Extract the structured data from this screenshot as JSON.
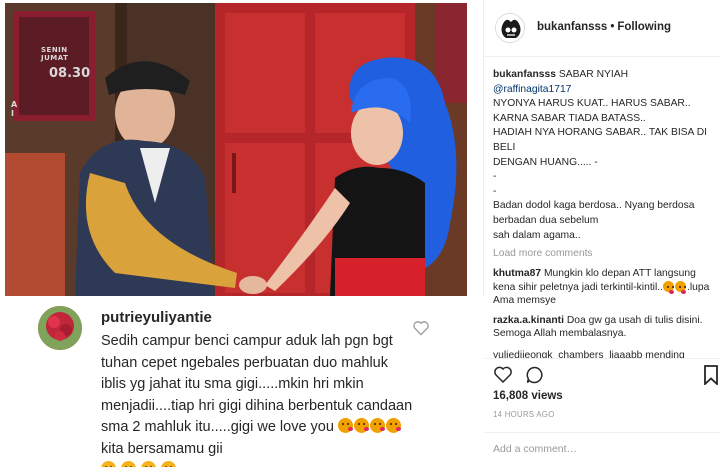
{
  "photo": {
    "wall_day": "SENIN\nJUMAT",
    "wall_time": "08.30",
    "wall_side": "A\nI"
  },
  "overlay_comment": {
    "username": "putrieyuliyantie",
    "text_main": "Sedih campur benci campur aduk lah pgn bgt tuhan cepet ngebales perbuatan duo mahluk iblis yg jahat itu sma gigi.....mkin hri mkin menjadii....tiap hri gigi dihina berbentuk candaan  sma 2 mahluk itu.....gigi we love you",
    "text_tail": "kita bersamamu gii"
  },
  "header": {
    "username": "bukanfansss",
    "separator": "•",
    "follow_status": "Following"
  },
  "caption": {
    "username": "bukanfansss",
    "title": "SABAR NYIAH",
    "mention": "@raffinagita1717",
    "lines": [
      "NYONYA HARUS KUAT.. HARUS SABAR..",
      "KARNA SABAR TIADA BATASS..",
      "HADIAH NYA HORANG SABAR.. TAK BISA DI BELI",
      "DENGAN HUANG..... -",
      "-",
      "-",
      "Badan dodol kaga berdosa.. Nyang berdosa berbadan dua sebelum",
      "sah dalam agama.."
    ]
  },
  "comments": {
    "load_more": "Load more comments",
    "items": [
      {
        "username": "khutma87",
        "text": "Mungkin klo depan ATT langsung kena sihir peletnya jadi terkintil-kintil..",
        "text_after": ".lupa Ama memsye"
      },
      {
        "username": "razka.a.kinanti",
        "text": "Doa gw ga usah di tulis disini. Semoga Allah membalasnya."
      }
    ],
    "clipped": "yuliedijeongk_chambers_liaaabb mending"
  },
  "actions": {
    "likes": "16,808 views",
    "timestamp": "14 HOURS AGO",
    "add_comment_placeholder": "Add a comment…"
  },
  "colors": {
    "link": "#003569",
    "muted": "#999999",
    "border": "#efefef"
  }
}
